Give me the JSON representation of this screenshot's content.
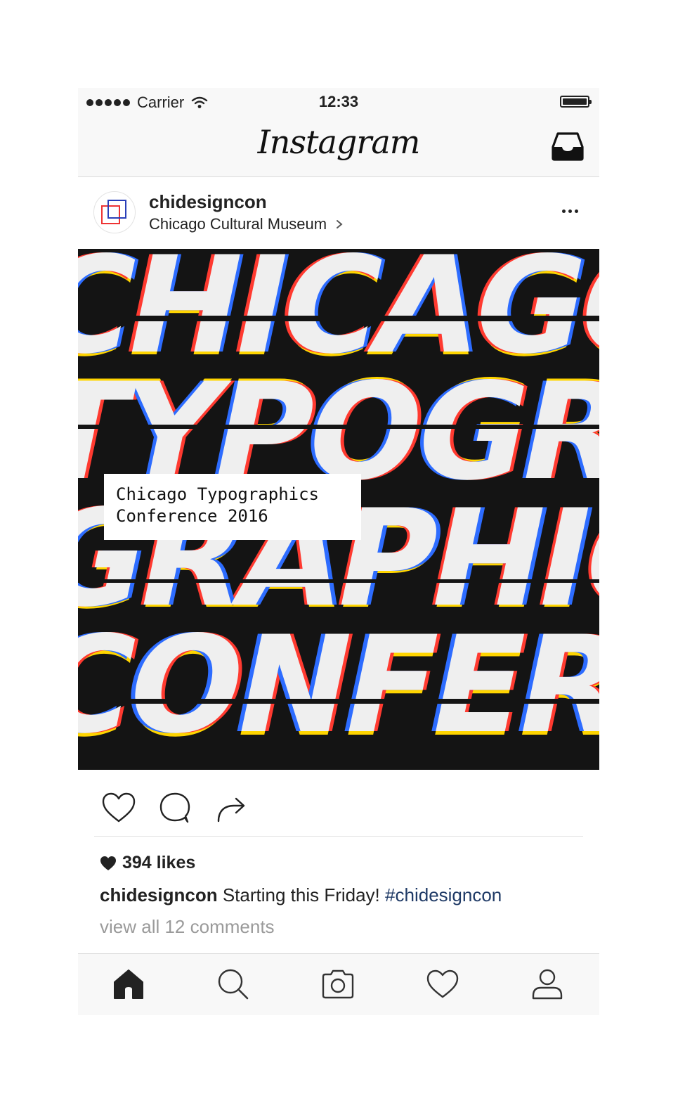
{
  "status_bar": {
    "carrier": "Carrier",
    "time": "12:33"
  },
  "nav": {
    "logo": "Instagram",
    "inbox_icon": "inbox-tray-icon"
  },
  "post": {
    "username": "chidesigncon",
    "location": "Chicago Cultural Museum",
    "image": {
      "background_words": [
        "CHICAGO",
        "TYPOGRAPHICS",
        "GRAPHICS",
        "CONFERENCE"
      ],
      "overlay_line1": "Chicago Typographics",
      "overlay_line2": "Conference 2016"
    },
    "likes": "394 likes",
    "caption_user": "chidesigncon",
    "caption_text": "Starting this Friday!",
    "caption_tag": "#chidesigncon",
    "comments_link": "view all 12 comments"
  },
  "tabs": [
    "home-icon",
    "search-icon",
    "camera-icon",
    "heart-icon",
    "profile-icon"
  ],
  "colors": {
    "bar_bg": "#f8f8f8",
    "hashtag": "#1f3a66",
    "muted": "#9a9a9a",
    "glitch_blue": "#2d6cff",
    "glitch_red": "#ff3a30",
    "glitch_yellow": "#ffd500"
  }
}
